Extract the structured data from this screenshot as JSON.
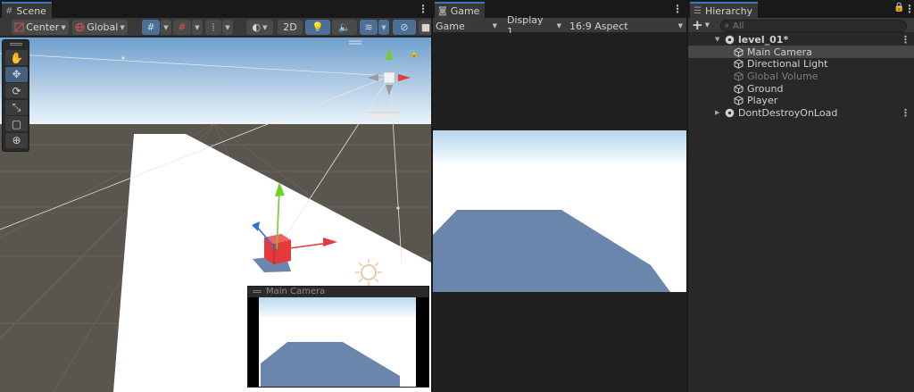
{
  "scene": {
    "tab_label": "Scene",
    "toolbar": {
      "pivot_label": "Center",
      "space_label": "Global",
      "mode_2d_label": "2D"
    },
    "tools": [
      {
        "name": "hand-tool",
        "icon": "hand-icon",
        "glyph": "✋",
        "active": false
      },
      {
        "name": "move-tool",
        "icon": "move-icon",
        "glyph": "✥",
        "active": true
      },
      {
        "name": "rotate-tool",
        "icon": "rotate-icon",
        "glyph": "⟳",
        "active": false
      },
      {
        "name": "scale-tool",
        "icon": "scale-icon",
        "glyph": "⤡",
        "active": false
      },
      {
        "name": "rect-tool",
        "icon": "rect-icon",
        "glyph": "▢",
        "active": false
      },
      {
        "name": "transform-tool",
        "icon": "transform-icon",
        "glyph": "⊕",
        "active": false
      }
    ],
    "camera_preview_title": "Main Camera"
  },
  "game": {
    "tab_label": "Game",
    "view_mode": "Game",
    "display": "Display 1",
    "aspect": "16:9 Aspect"
  },
  "hierarchy": {
    "tab_label": "Hierarchy",
    "add_label": "+",
    "search_placeholder": "All",
    "scene_name": "level_01*",
    "objects": [
      {
        "label": "Main Camera",
        "selected": true,
        "active": true
      },
      {
        "label": "Directional Light",
        "selected": false,
        "active": true
      },
      {
        "label": "Global Volume",
        "selected": false,
        "active": false
      },
      {
        "label": "Ground",
        "selected": false,
        "active": true
      },
      {
        "label": "Player",
        "selected": false,
        "active": true
      }
    ],
    "dont_destroy_label": "DontDestroyOnLoad"
  },
  "colors": {
    "accent": "#3a79bb",
    "selection": "#474747",
    "sky_top": "#6f9fcc",
    "sky_horizon": "#eaf4fb",
    "ground_scene": "#5b554f",
    "plane": "#ffffff",
    "shadow": "#6a86ad",
    "cube": "#e23a3a",
    "axis_x": "#e8383a",
    "axis_y": "#6fd02c",
    "axis_z": "#2f6fe0"
  }
}
